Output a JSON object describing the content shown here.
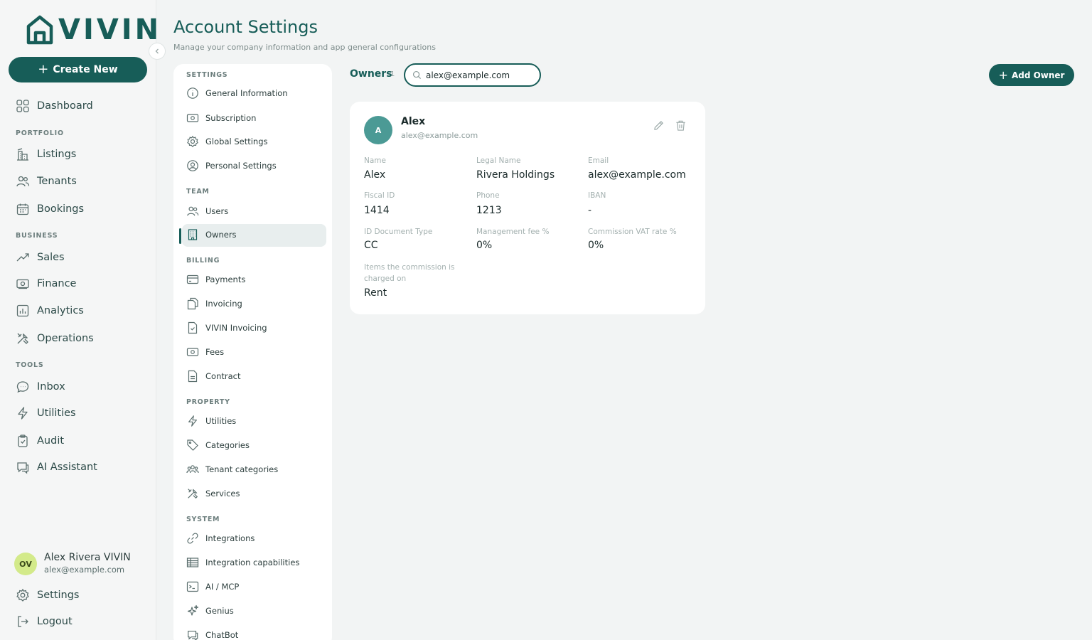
{
  "brand": {
    "logo_text": "VIVIN"
  },
  "sidebar": {
    "create_label": "Create New",
    "items": {
      "dashboard": "Dashboard",
      "listings": "Listings",
      "tenants": "Tenants",
      "bookings": "Bookings",
      "sales": "Sales",
      "finance": "Finance",
      "analytics": "Analytics",
      "operations": "Operations",
      "inbox": "Inbox",
      "utilities": "Utilities",
      "audit": "Audit",
      "ai_assistant": "AI Assistant",
      "settings": "Settings",
      "logout": "Logout"
    },
    "sections": {
      "portfolio": "PORTFOLIO",
      "business": "BUSINESS",
      "tools": "TOOLS"
    },
    "user": {
      "initials": "ОV",
      "name": "Alex Rivera VIVIN",
      "email": "alex@example.com"
    }
  },
  "header": {
    "title": "Account Settings",
    "subtitle": "Manage your company information and app general configurations"
  },
  "settings_nav": {
    "sections": {
      "settings": "SETTINGS",
      "team": "TEAM",
      "billing": "BILLING",
      "property": "PROPERTY",
      "system": "SYSTEM"
    },
    "items": {
      "general_information": "General Information",
      "subscription": "Subscription",
      "global_settings": "Global Settings",
      "personal_settings": "Personal Settings",
      "users": "Users",
      "owners": "Owners",
      "payments": "Payments",
      "invoicing": "Invoicing",
      "vivin_invoicing": "VIVIN Invoicing",
      "fees": "Fees",
      "contract": "Contract",
      "utilities": "Utilities",
      "categories": "Categories",
      "tenant_categories": "Tenant categories",
      "services": "Services",
      "integrations": "Integrations",
      "integration_capabilities": "Integration capabilities",
      "ai_mcp": "AI / MCP",
      "genius": "Genius",
      "chatbot": "ChatBot"
    },
    "active": "owners"
  },
  "owners": {
    "title": "Owners",
    "count": "1",
    "search_value": "alex@example.com",
    "add_label": "Add Owner",
    "card": {
      "initial": "A",
      "name": "Alex",
      "email": "alex@example.com",
      "fields": {
        "name_label": "Name",
        "name_value": "Alex",
        "legal_label": "Legal Name",
        "legal_value": "Rivera Holdings",
        "email_label": "Email",
        "email_value": "alex@example.com",
        "fiscal_label": "Fiscal ID",
        "fiscal_value": "1414",
        "phone_label": "Phone",
        "phone_value": "1213",
        "iban_label": "IBAN",
        "iban_value": "-",
        "iddoc_label": "ID Document Type",
        "iddoc_value": "CC",
        "mgmt_label": "Management fee %",
        "mgmt_value": "0%",
        "vat_label": "Commission VAT rate %",
        "vat_value": "0%",
        "items_label": "Items the commission is charged on",
        "items_value": "Rent"
      }
    }
  },
  "colors": {
    "brand": "#175d58",
    "background": "#f2f4f4",
    "avatar": "#4b9a95",
    "user_avatar": "#d3ea8a"
  }
}
